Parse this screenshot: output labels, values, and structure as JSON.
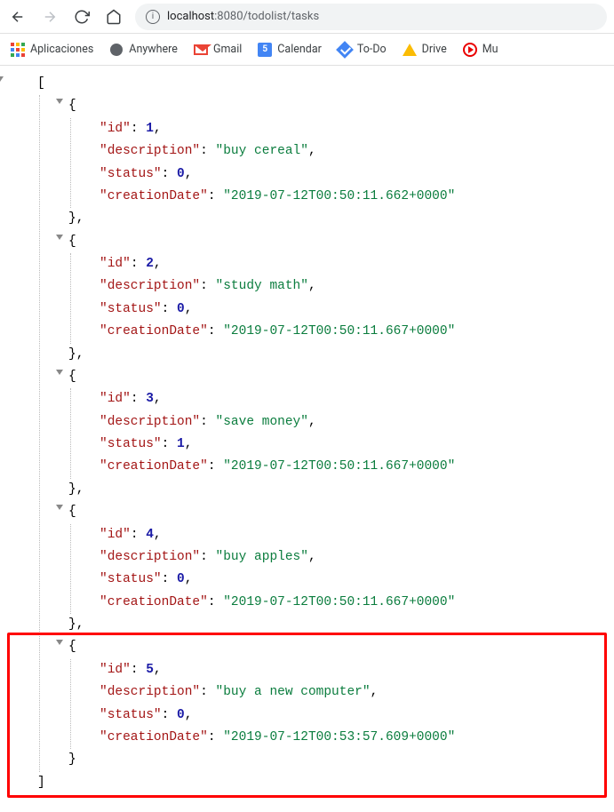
{
  "toolbar": {
    "back_label": "Back",
    "forward_label": "Forward",
    "reload_label": "Reload",
    "home_label": "Home"
  },
  "address": {
    "info_label": "Site information",
    "host": "localhost",
    "port": ":8080",
    "path": "/todolist/tasks"
  },
  "bookmarks": [
    {
      "label": "Aplicaciones",
      "icon": "apps"
    },
    {
      "label": "Anywhere",
      "icon": "globe"
    },
    {
      "label": "Gmail",
      "icon": "gmail"
    },
    {
      "label": "Calendar",
      "icon": "calendar",
      "badge": "5"
    },
    {
      "label": "To-Do",
      "icon": "todo"
    },
    {
      "label": "Drive",
      "icon": "drive"
    },
    {
      "label": "Mu",
      "icon": "music"
    }
  ],
  "json_response": [
    {
      "id": 1,
      "description": "buy cereal",
      "status": 0,
      "creationDate": "2019-07-12T00:50:11.662+0000"
    },
    {
      "id": 2,
      "description": "study math",
      "status": 0,
      "creationDate": "2019-07-12T00:50:11.667+0000"
    },
    {
      "id": 3,
      "description": "save money",
      "status": 1,
      "creationDate": "2019-07-12T00:50:11.667+0000"
    },
    {
      "id": 4,
      "description": "buy apples",
      "status": 0,
      "creationDate": "2019-07-12T00:50:11.667+0000"
    },
    {
      "id": 5,
      "description": "buy a new computer",
      "status": 0,
      "creationDate": "2019-07-12T00:53:57.609+0000"
    }
  ],
  "highlight_index": 4
}
